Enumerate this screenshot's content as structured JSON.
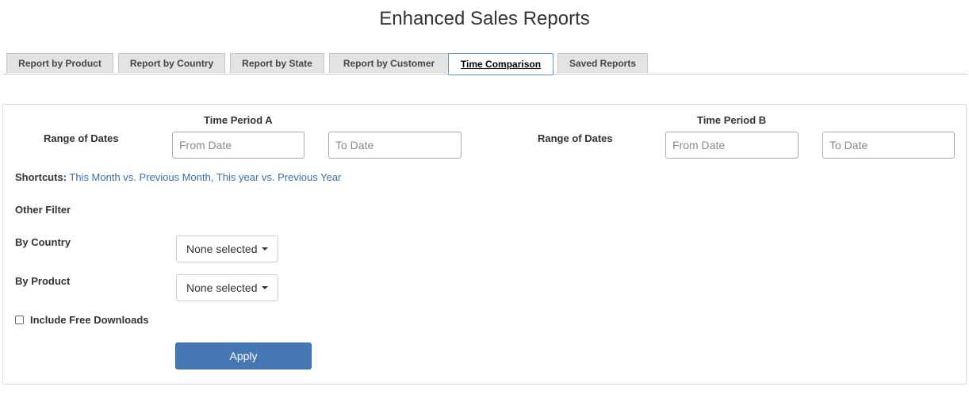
{
  "page": {
    "title": "Enhanced Sales Reports"
  },
  "tabs": [
    {
      "label": "Report by Product"
    },
    {
      "label": "Report by Country"
    },
    {
      "label": "Report by State"
    },
    {
      "label": "Report by Customer"
    },
    {
      "label": "Time Comparison",
      "active": true
    },
    {
      "label": "Saved Reports"
    }
  ],
  "period_a": {
    "title": "Time Period A",
    "range_label": "Range of Dates",
    "from": {
      "value": "",
      "placeholder": "From Date"
    },
    "to": {
      "value": "",
      "placeholder": "To Date"
    }
  },
  "period_b": {
    "title": "Time Period B",
    "range_label": "Range of Dates",
    "from": {
      "value": "",
      "placeholder": "From Date"
    },
    "to": {
      "value": "",
      "placeholder": "To Date"
    }
  },
  "shortcuts": {
    "label": "Shortcuts:",
    "links": [
      "This Month vs. Previous Month",
      "This year vs. Previous Year"
    ],
    "separator": ", "
  },
  "filters": {
    "heading": "Other Filter",
    "country": {
      "label": "By Country",
      "selected": "None selected"
    },
    "product": {
      "label": "By Product",
      "selected": "None selected"
    },
    "free_downloads": {
      "label": "Include Free Downloads",
      "checked": false
    }
  },
  "actions": {
    "apply_label": "Apply"
  },
  "colors": {
    "accent": "#4477b4",
    "link": "#3b6fa6",
    "active_tab_border": "#5f95c7"
  }
}
